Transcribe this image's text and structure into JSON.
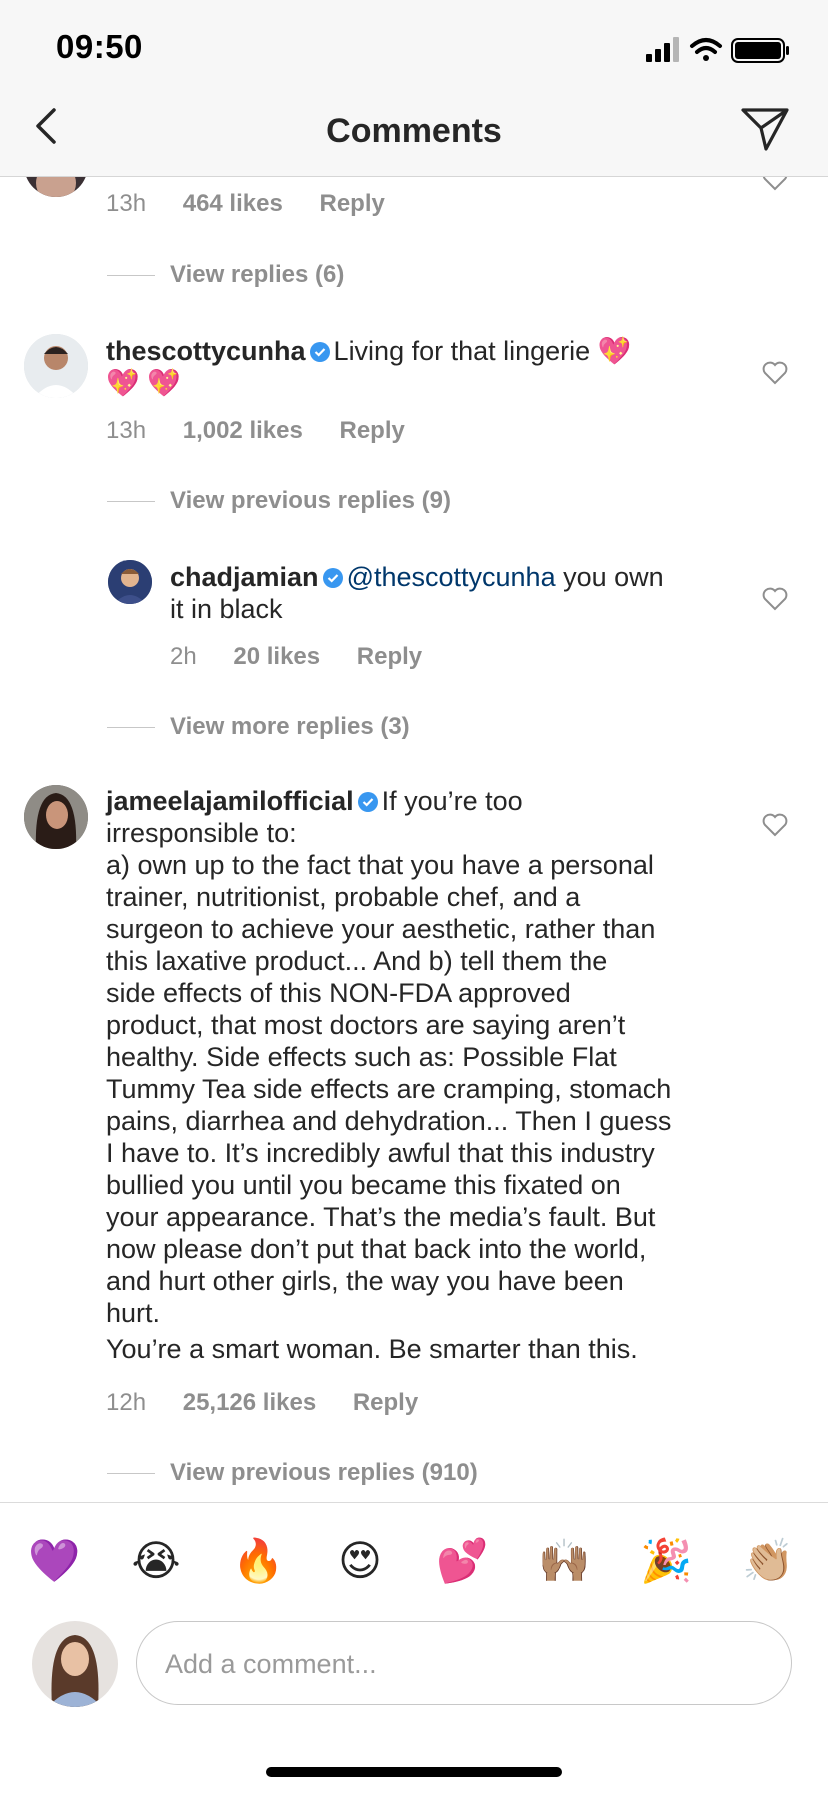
{
  "status": {
    "time": "09:50"
  },
  "nav": {
    "title": "Comments"
  },
  "comments": [
    {
      "id": "c0",
      "time": "13h",
      "likes": "464 likes",
      "reply": "Reply",
      "view_replies": "View replies (6)"
    },
    {
      "id": "c1",
      "username": "thescottycunha",
      "text_line1": "Living for that lingerie 💖",
      "text_line2": "💖 💖",
      "time": "13h",
      "likes": "1,002 likes",
      "reply": "Reply",
      "view_replies": "View previous replies (9)"
    },
    {
      "id": "c2",
      "username": "chadjamian",
      "mention": "@thescottycunha",
      "text_line1_rest": "you own",
      "text_line2": "it in black",
      "time": "2h",
      "likes": "20 likes",
      "reply": "Reply",
      "view_replies": "View more replies (3)"
    },
    {
      "id": "c3",
      "username": "jameelajamilofficial",
      "text_first": "If you’re too",
      "lines": [
        "irresponsible to:",
        "a) own up to the fact that you have a personal",
        "trainer, nutritionist, probable chef, and a",
        "surgeon to achieve your aesthetic, rather than",
        "this laxative product... And b) tell them the",
        "side effects of this NON-FDA approved",
        "product, that most doctors are saying aren’t",
        "healthy. Side effects such as: Possible Flat",
        "Tummy Tea side effects are cramping, stomach",
        "pains, diarrhea and dehydration... Then I guess",
        "I have to. It’s incredibly awful that this industry",
        "bullied you until you became this fixated on",
        "your appearance. That’s the media’s fault. But",
        "now please don’t put that back into the world,",
        "and hurt other girls, the way you have been",
        "hurt."
      ],
      "last_line": "You’re a smart woman. Be smarter than this.",
      "time": "12h",
      "likes": "25,126 likes",
      "reply": "Reply",
      "view_replies": "View previous replies (910)"
    }
  ],
  "emoji_bar": [
    "💜",
    "😭",
    "🔥",
    "😍",
    "💕",
    "🙌🏽",
    "🎉",
    "👏🏼"
  ],
  "composer": {
    "placeholder": "Add a comment..."
  },
  "colors": {
    "verified": "#3897f0",
    "mention": "#00376b",
    "muted": "#8e8e8e"
  }
}
